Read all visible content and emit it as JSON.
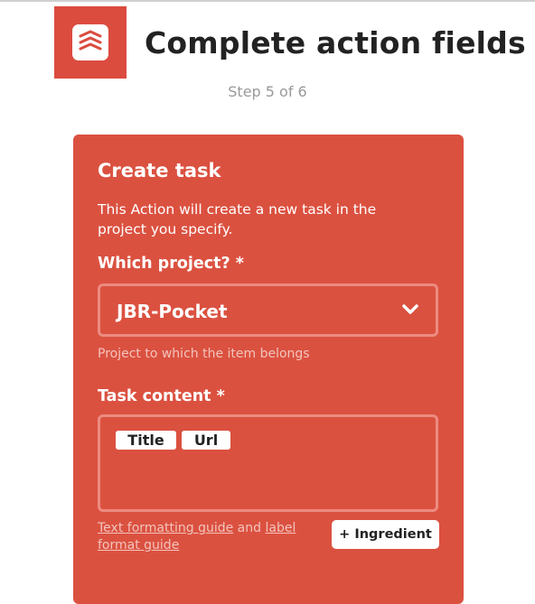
{
  "header": {
    "title": "Complete action fields",
    "step": "Step 5 of 6",
    "logo_icon": "todoist-logo-icon",
    "brand_color": "#db4c3f"
  },
  "card": {
    "title": "Create task",
    "description": "This Action will create a new task in the project you specify.",
    "background_color": "#db5140",
    "project_field": {
      "label": "Which project? *",
      "selected_value": "JBR-Pocket",
      "dropdown_icon": "chevron-down-icon",
      "helper": "Project to which the item belongs"
    },
    "content_field": {
      "label": "Task content *",
      "ingredients": [
        "Title",
        "Url"
      ]
    },
    "guide": {
      "link1": "Text formatting guide",
      "conjunction": "and",
      "link2": "label format guide"
    },
    "ingredient_button": "+ Ingredient"
  }
}
